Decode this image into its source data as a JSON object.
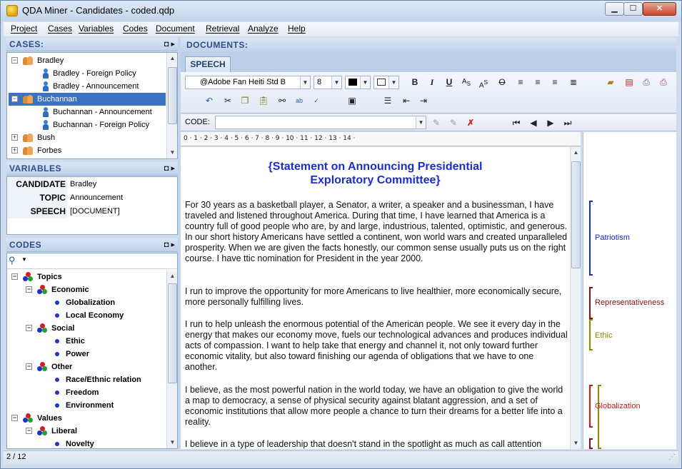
{
  "window": {
    "title": "QDA Miner - Candidates - coded.qdp"
  },
  "menu": [
    "Project",
    "Cases",
    "Variables",
    "Codes",
    "Document",
    "Retrieval",
    "Analyze",
    "Help"
  ],
  "cases": {
    "header": "CASES:",
    "items": [
      {
        "label": "Bradley"
      },
      {
        "label": "Bradley - Foreign Policy"
      },
      {
        "label": "Bradley - Announcement"
      },
      {
        "label": "Buchannan"
      },
      {
        "label": "Buchannan - Announcement"
      },
      {
        "label": "Buchannan - Foreign Policy"
      },
      {
        "label": "Bush"
      },
      {
        "label": "Forbes"
      }
    ]
  },
  "variables": {
    "header": "VARIABLES",
    "rows": [
      {
        "name": "CANDIDATE",
        "value": "Bradley"
      },
      {
        "name": "TOPIC",
        "value": "Announcement"
      },
      {
        "name": "SPEECH",
        "value": "[DOCUMENT]"
      }
    ]
  },
  "codes": {
    "header": "CODES",
    "items": [
      {
        "label": "Topics"
      },
      {
        "label": "Economic"
      },
      {
        "label": "Globalization"
      },
      {
        "label": "Local Economy"
      },
      {
        "label": "Social"
      },
      {
        "label": "Ethic"
      },
      {
        "label": "Power"
      },
      {
        "label": "Other"
      },
      {
        "label": "Race/Ethnic relation"
      },
      {
        "label": "Freedom"
      },
      {
        "label": "Environment"
      },
      {
        "label": "Values"
      },
      {
        "label": "Liberal"
      },
      {
        "label": "Novelty"
      }
    ]
  },
  "documents": {
    "header": "DOCUMENTS:",
    "tab": "SPEECH",
    "font_name": "@Adobe Fan Heiti Std B",
    "font_size": "8",
    "code_label": "CODE:",
    "ruler": "0 · 1 · 2 · 3 · 4 · 5 · 6 · 7 · 8 · 9 · 10 · 11 · 12 · 13 · 14 ·",
    "title_line1": "{Statement on Announcing Presidential",
    "title_line2": "Exploratory Committee}",
    "paragraphs": [
      "For 30 years as a basketball player, a Senator, a writer, a speaker and a businessman, I have traveled and listened throughout America. During that time, I have learned that America is a country full of good people who are, by and large, industrious, talented, optimistic, and generous. In our short history Americans have settled a continent, won world wars and created unparalleled prosperity. When we are given the facts honestly, our common sense usually puts us on the right course. I have ttic nomination for President in the year 2000.",
      "I run to improve the opportunity for more Americans to live healthier, more economically secure, more personally fulfilling lives.",
      "I run to help unleash the enormous potential of the American people. We see it every day in the energy that makes our economy move, fuels our technological advances and produces individual acts of compassion. I want to help take that energy and channel it, not only toward further economic vitality, but also toward finishing our agenda of obligations that we have to one another.",
      "I believe, as the most powerful nation in the world today, we have an obligation to give the world a map to democracy, a sense of physical security against blatant aggression, and a set of economic institutions that allow more people a chance to turn their dreams for a better life into a reality.",
      "I believe in a type of leadership that doesn't stand in the spotlight as much as call attention"
    ],
    "margin_codes": [
      {
        "label": "Patriotism",
        "color": "#1a2bd0"
      },
      {
        "label": "Representativeness",
        "color": "#8b1010"
      },
      {
        "label": "Ethic",
        "color": "#8c8a00"
      },
      {
        "label": "Globalization",
        "color": "#d01a1a"
      }
    ]
  },
  "status": {
    "record": "2 / 12"
  },
  "colors": {
    "accent": "#2b4e8a",
    "title_text": "#1b2ed0"
  }
}
